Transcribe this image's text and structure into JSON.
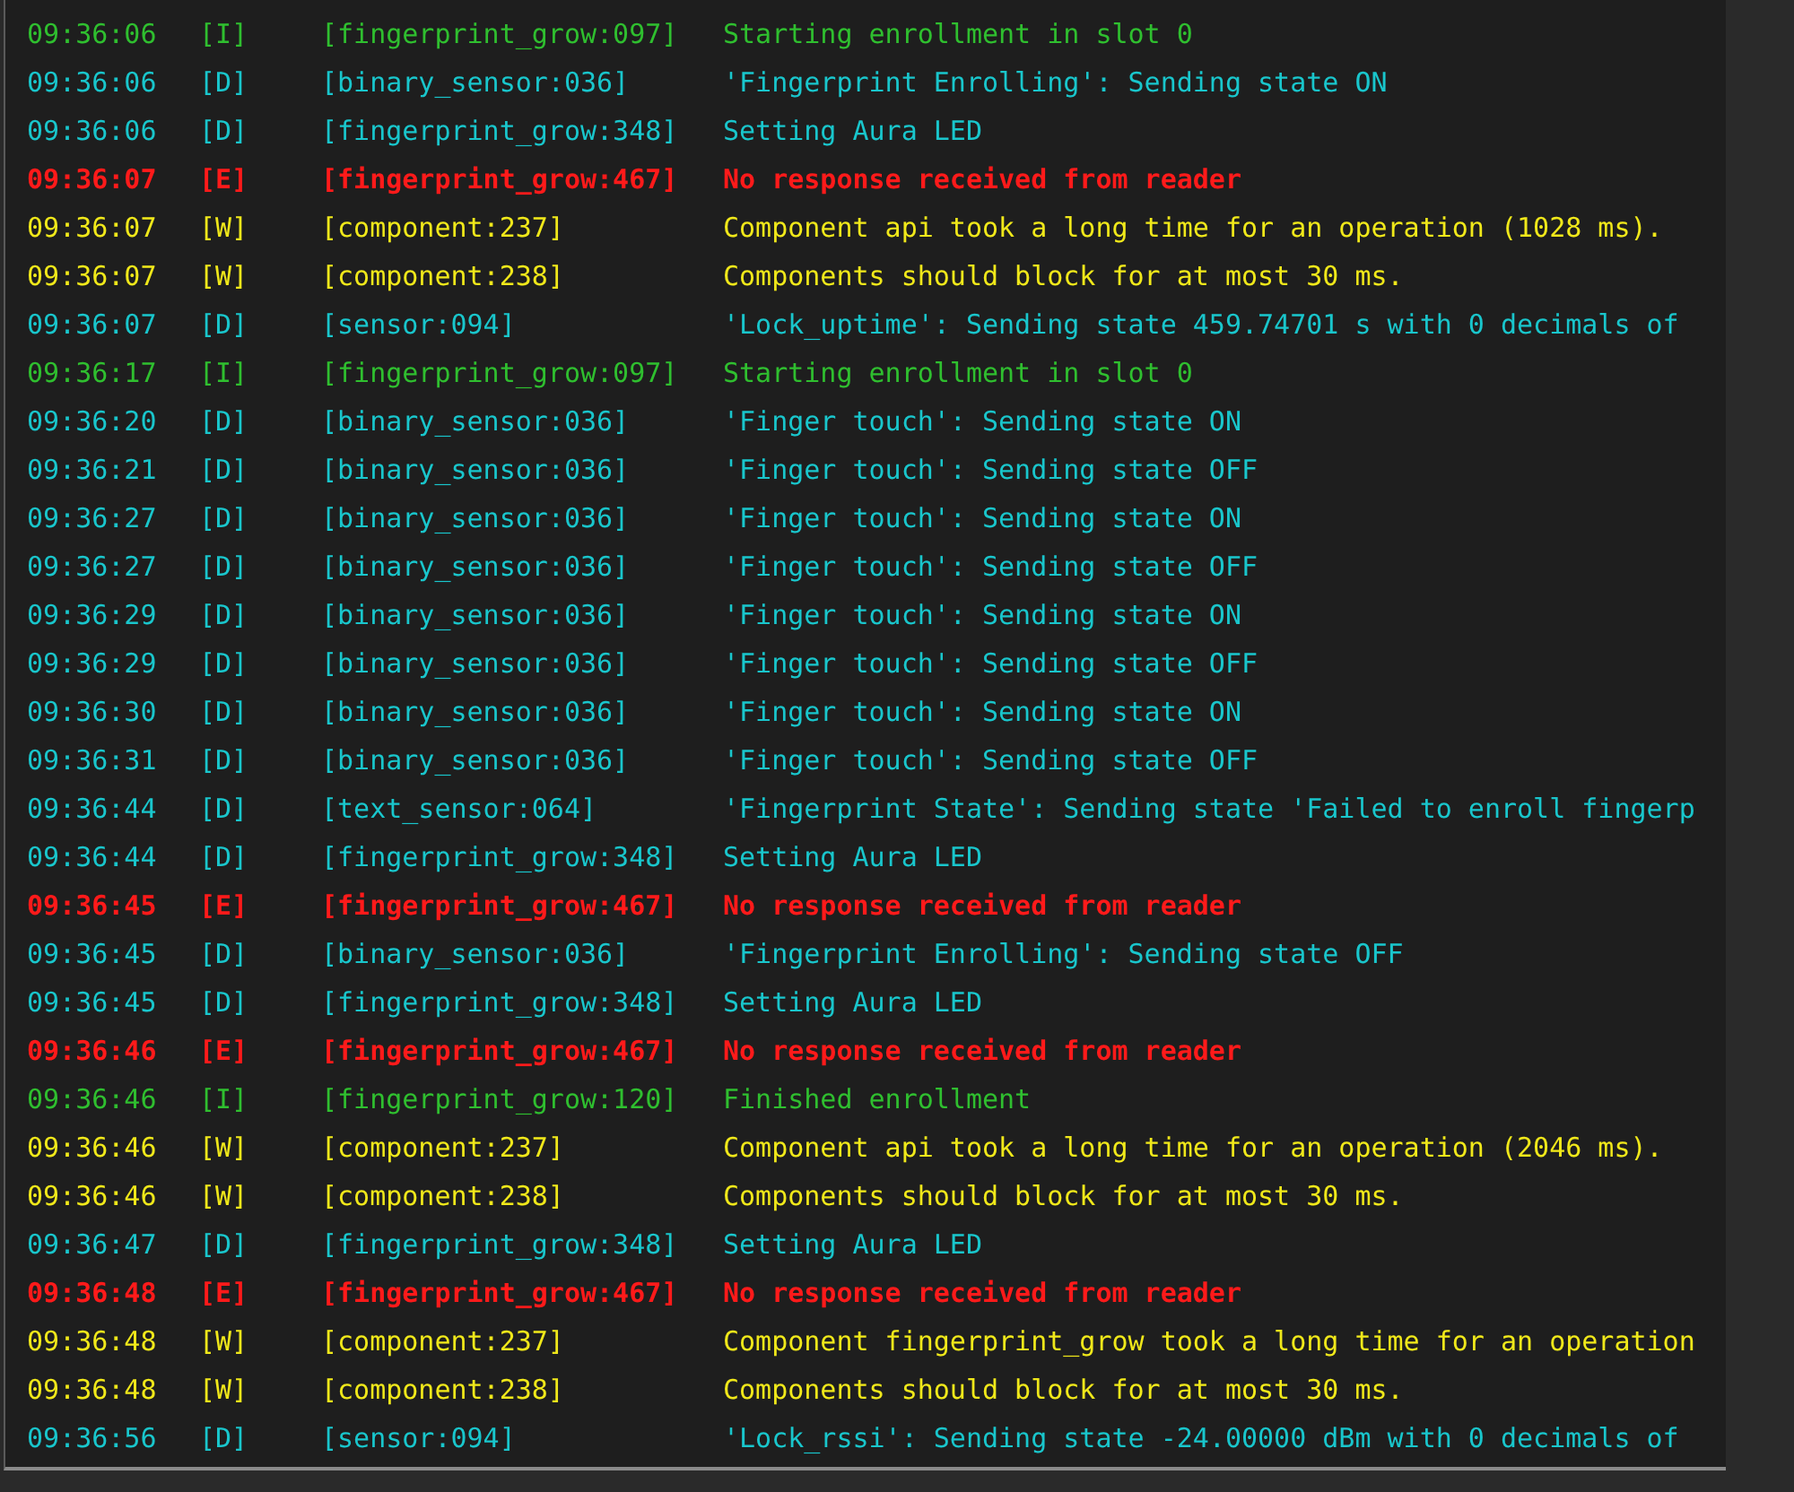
{
  "log": [
    {
      "time": "09:36:06",
      "kind": "info",
      "severity": "[I]",
      "tag": "[fingerprint_grow:097]",
      "message": "Starting enrollment in slot 0"
    },
    {
      "time": "09:36:06",
      "kind": "debug",
      "severity": "[D]",
      "tag": "[binary_sensor:036]",
      "message": "'Fingerprint Enrolling': Sending state ON"
    },
    {
      "time": "09:36:06",
      "kind": "debug",
      "severity": "[D]",
      "tag": "[fingerprint_grow:348]",
      "message": "Setting Aura LED"
    },
    {
      "time": "09:36:07",
      "kind": "error",
      "severity": "[E]",
      "tag": "[fingerprint_grow:467]",
      "message": "No response received from reader"
    },
    {
      "time": "09:36:07",
      "kind": "warning",
      "severity": "[W]",
      "tag": "[component:237]",
      "message": "Component api took a long time for an operation (1028 ms)."
    },
    {
      "time": "09:36:07",
      "kind": "warning",
      "severity": "[W]",
      "tag": "[component:238]",
      "message": "Components should block for at most 30 ms."
    },
    {
      "time": "09:36:07",
      "kind": "debug",
      "severity": "[D]",
      "tag": "[sensor:094]",
      "message": "'Lock_uptime': Sending state 459.74701 s with 0 decimals of"
    },
    {
      "time": "09:36:17",
      "kind": "info",
      "severity": "[I]",
      "tag": "[fingerprint_grow:097]",
      "message": "Starting enrollment in slot 0"
    },
    {
      "time": "09:36:20",
      "kind": "debug",
      "severity": "[D]",
      "tag": "[binary_sensor:036]",
      "message": "'Finger touch': Sending state ON"
    },
    {
      "time": "09:36:21",
      "kind": "debug",
      "severity": "[D]",
      "tag": "[binary_sensor:036]",
      "message": "'Finger touch': Sending state OFF"
    },
    {
      "time": "09:36:27",
      "kind": "debug",
      "severity": "[D]",
      "tag": "[binary_sensor:036]",
      "message": "'Finger touch': Sending state ON"
    },
    {
      "time": "09:36:27",
      "kind": "debug",
      "severity": "[D]",
      "tag": "[binary_sensor:036]",
      "message": "'Finger touch': Sending state OFF"
    },
    {
      "time": "09:36:29",
      "kind": "debug",
      "severity": "[D]",
      "tag": "[binary_sensor:036]",
      "message": "'Finger touch': Sending state ON"
    },
    {
      "time": "09:36:29",
      "kind": "debug",
      "severity": "[D]",
      "tag": "[binary_sensor:036]",
      "message": "'Finger touch': Sending state OFF"
    },
    {
      "time": "09:36:30",
      "kind": "debug",
      "severity": "[D]",
      "tag": "[binary_sensor:036]",
      "message": "'Finger touch': Sending state ON"
    },
    {
      "time": "09:36:31",
      "kind": "debug",
      "severity": "[D]",
      "tag": "[binary_sensor:036]",
      "message": "'Finger touch': Sending state OFF"
    },
    {
      "time": "09:36:44",
      "kind": "debug",
      "severity": "[D]",
      "tag": "[text_sensor:064]",
      "message": "'Fingerprint State': Sending state 'Failed to enroll fingerp"
    },
    {
      "time": "09:36:44",
      "kind": "debug",
      "severity": "[D]",
      "tag": "[fingerprint_grow:348]",
      "message": "Setting Aura LED"
    },
    {
      "time": "09:36:45",
      "kind": "error",
      "severity": "[E]",
      "tag": "[fingerprint_grow:467]",
      "message": "No response received from reader"
    },
    {
      "time": "09:36:45",
      "kind": "debug",
      "severity": "[D]",
      "tag": "[binary_sensor:036]",
      "message": "'Fingerprint Enrolling': Sending state OFF"
    },
    {
      "time": "09:36:45",
      "kind": "debug",
      "severity": "[D]",
      "tag": "[fingerprint_grow:348]",
      "message": "Setting Aura LED"
    },
    {
      "time": "09:36:46",
      "kind": "error",
      "severity": "[E]",
      "tag": "[fingerprint_grow:467]",
      "message": "No response received from reader"
    },
    {
      "time": "09:36:46",
      "kind": "info",
      "severity": "[I]",
      "tag": "[fingerprint_grow:120]",
      "message": "Finished enrollment"
    },
    {
      "time": "09:36:46",
      "kind": "warning",
      "severity": "[W]",
      "tag": "[component:237]",
      "message": "Component api took a long time for an operation (2046 ms)."
    },
    {
      "time": "09:36:46",
      "kind": "warning",
      "severity": "[W]",
      "tag": "[component:238]",
      "message": "Components should block for at most 30 ms."
    },
    {
      "time": "09:36:47",
      "kind": "debug",
      "severity": "[D]",
      "tag": "[fingerprint_grow:348]",
      "message": "Setting Aura LED"
    },
    {
      "time": "09:36:48",
      "kind": "error",
      "severity": "[E]",
      "tag": "[fingerprint_grow:467]",
      "message": "No response received from reader"
    },
    {
      "time": "09:36:48",
      "kind": "warning",
      "severity": "[W]",
      "tag": "[component:237]",
      "message": "Component fingerprint_grow took a long time for an operation"
    },
    {
      "time": "09:36:48",
      "kind": "warning",
      "severity": "[W]",
      "tag": "[component:238]",
      "message": "Components should block for at most 30 ms."
    },
    {
      "time": "09:36:56",
      "kind": "debug",
      "severity": "[D]",
      "tag": "[sensor:094]",
      "message": "'Lock_rssi': Sending state -24.00000 dBm with 0 decimals of"
    }
  ]
}
